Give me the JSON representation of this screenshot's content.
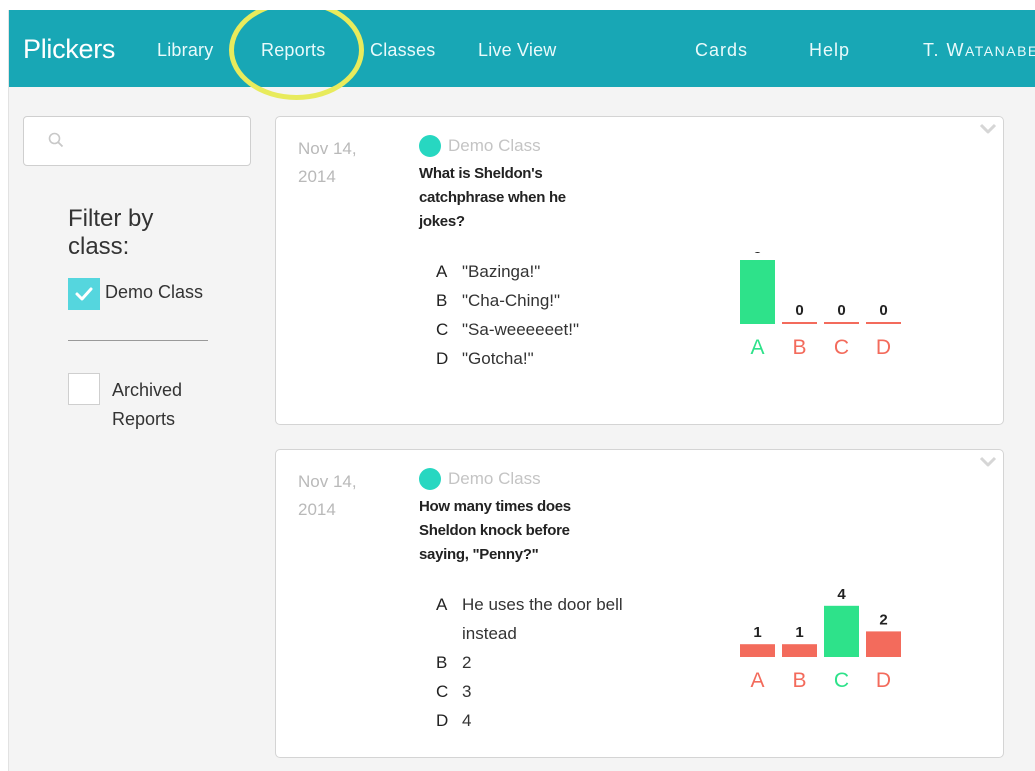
{
  "nav": {
    "brand": "Plickers",
    "links": [
      "Library",
      "Reports",
      "Classes",
      "Live View",
      "Cards",
      "Help"
    ],
    "user_first": "T. W",
    "user_rest": "ATANABE"
  },
  "sidebar": {
    "search_placeholder": "",
    "filter_title_line1": "Filter by",
    "filter_title_line2": "class:",
    "class_filter": "Demo Class",
    "archived_line1": "Archived",
    "archived_line2": "Reports"
  },
  "colors": {
    "nav": "#18a7b5",
    "correct": "#2ee28a",
    "incorrect": "#f36b5c",
    "class_dot": "#27d7c1",
    "check": "#55d6de"
  },
  "reports": [
    {
      "date_line1": "Nov 14,",
      "date_line2": "2014",
      "class_name": "Demo Class",
      "question_lines": [
        "What is Sheldon's",
        "catchphrase when he",
        "jokes?"
      ],
      "answers": [
        {
          "letter": "A",
          "text": "\"Bazinga!\""
        },
        {
          "letter": "B",
          "text": "\"Cha-Ching!\""
        },
        {
          "letter": "C",
          "text": "\"Sa-weeeeeet!\""
        },
        {
          "letter": "D",
          "text": "\"Gotcha!\""
        }
      ]
    },
    {
      "date_line1": "Nov 14,",
      "date_line2": "2014",
      "class_name": "Demo Class",
      "question_lines": [
        "How many times does",
        "Sheldon knock before",
        "saying, \"Penny?\""
      ],
      "answers": [
        {
          "letter": "A",
          "text": "He uses the door bell"
        },
        {
          "letter": "",
          "text": "instead"
        },
        {
          "letter": "B",
          "text": "2"
        },
        {
          "letter": "C",
          "text": "3"
        },
        {
          "letter": "D",
          "text": "4"
        }
      ]
    }
  ],
  "chart_data": [
    {
      "type": "bar",
      "categories": [
        "A",
        "B",
        "C",
        "D"
      ],
      "values": [
        5,
        0,
        0,
        0
      ],
      "correct": "A",
      "ylim": [
        0,
        5
      ]
    },
    {
      "type": "bar",
      "categories": [
        "A",
        "B",
        "C",
        "D"
      ],
      "values": [
        1,
        1,
        4,
        2
      ],
      "correct": "C",
      "ylim": [
        0,
        5
      ]
    }
  ]
}
